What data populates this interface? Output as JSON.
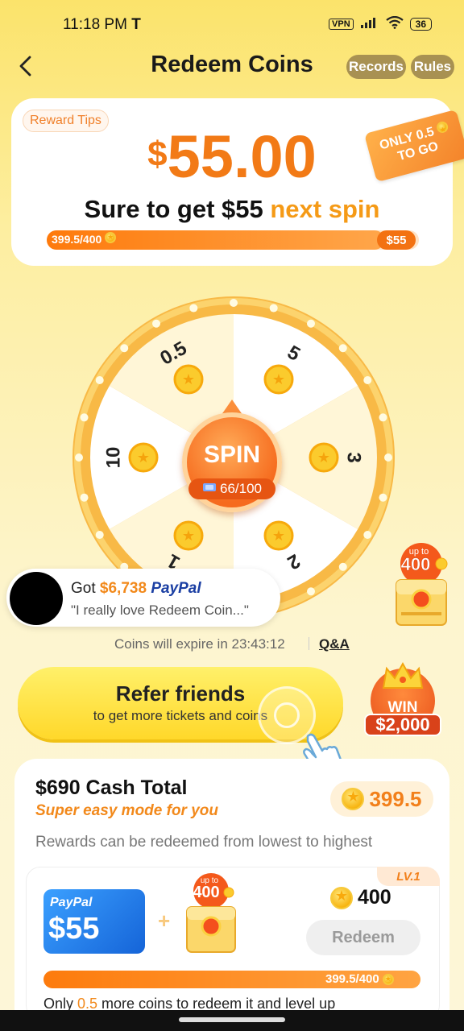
{
  "status_bar": {
    "time": "11:18 PM",
    "carrier_icon": "T",
    "vpn": "VPN",
    "battery": "36"
  },
  "header": {
    "title": "Redeem Coins",
    "records": "Records",
    "rules": "Rules"
  },
  "reward_card": {
    "tips": "Reward Tips",
    "amount_symbol": "$",
    "amount": "55.00",
    "only_tag_line1": "ONLY 0.5",
    "only_tag_line2": "TO GO",
    "sure_prefix": "Sure to get $55 ",
    "sure_suffix": "next spin",
    "progress_text": "399.5/400",
    "progress_fraction": 0.99875,
    "progress_end": "$55"
  },
  "wheel": {
    "segments": [
      "5",
      "3",
      "2",
      "1",
      "10",
      "0.5"
    ],
    "spin_label": "SPIN",
    "tickets": "66/100"
  },
  "chest_badge": {
    "up_to": "up to",
    "amount": "400"
  },
  "notification": {
    "got": "Got ",
    "amount": "$6,738",
    "brand": "PayPal",
    "quote": "\"I really love Redeem Coin...\""
  },
  "expire": {
    "text": "Coins will expire in 23:43:12",
    "qa": "Q&A"
  },
  "refer": {
    "title": "Refer friends",
    "subtitle": "to get more tickets and coins",
    "win": "WIN",
    "win_amount": "$2,000"
  },
  "cash": {
    "total": "$690 Cash Total",
    "mode": "Super easy mode for you",
    "balance": "399.5",
    "note": "Rewards can be redeemed from lowest to highest"
  },
  "reward_item": {
    "level": "LV.1",
    "card_brand": "PayPal",
    "card_amount": "$55",
    "plus": "+",
    "chest_up_to": "up to",
    "chest_amount": "400",
    "coins_required": "400",
    "redeem": "Redeem",
    "progress_text": "399.5/400",
    "footer_prefix": "Only ",
    "footer_value": "0.5",
    "footer_suffix": " more coins to redeem it and level up"
  },
  "colors": {
    "accent": "#f27a16",
    "yellow_bg": "#fbe36b",
    "paypal_blue": "#1564d8"
  }
}
